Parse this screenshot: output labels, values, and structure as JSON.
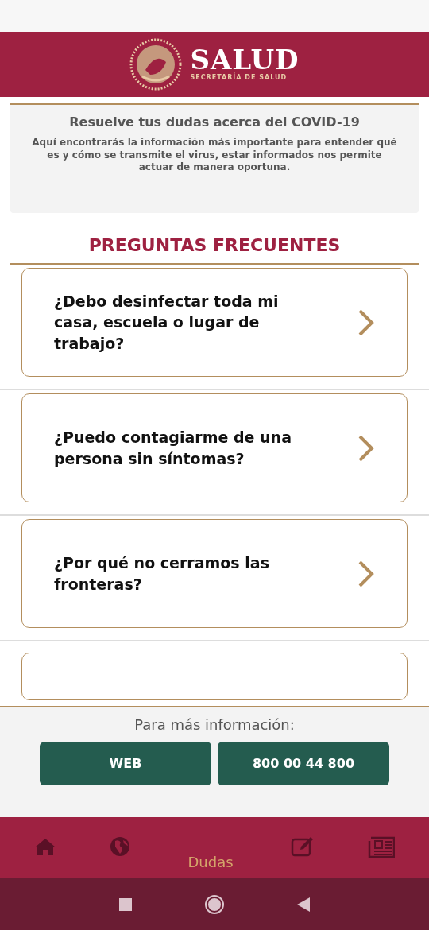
{
  "header": {
    "title": "SALUD",
    "subtitle": "SECRETARÍA DE SALUD"
  },
  "intro": {
    "title": "Resuelve tus dudas acerca del COVID-19",
    "text": "Aquí encontrarás la información más importante para entender qué es y cómo se transmite el virus, estar informados nos permite actuar de manera oportuna."
  },
  "section_title": "PREGUNTAS FRECUENTES",
  "questions": [
    {
      "text": "¿Debo desinfectar toda mi casa, escuela o lugar de trabajo?"
    },
    {
      "text": "¿Puedo contagiarme de una persona sin síntomas?"
    },
    {
      "text": "¿Por qué no cerramos las fronteras?"
    }
  ],
  "more_below": true,
  "footer": {
    "text": "Para más información:",
    "buttons": [
      "WEB",
      "800 00 44 800"
    ]
  },
  "bottom_nav": [
    {
      "kind": "home",
      "selected": false
    },
    {
      "kind": "globe",
      "selected": false
    },
    {
      "kind": "label",
      "label": "Dudas",
      "selected": true
    },
    {
      "kind": "edit",
      "selected": false
    },
    {
      "kind": "news",
      "selected": false
    }
  ]
}
